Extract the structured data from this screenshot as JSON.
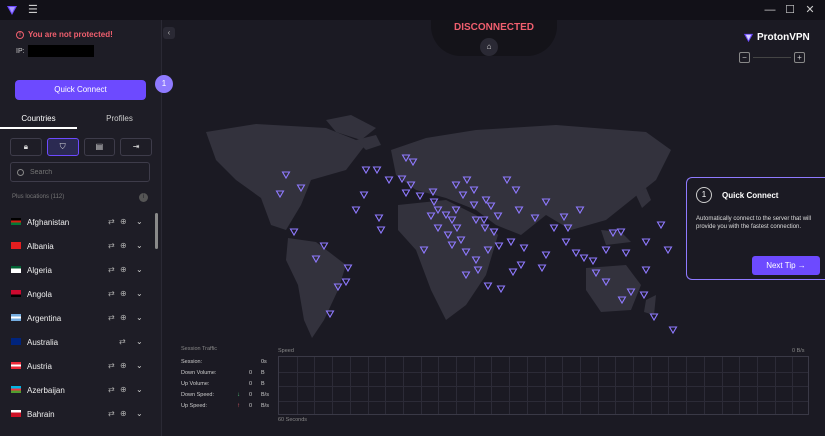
{
  "window": {
    "minimize": "—",
    "maximize": "☐",
    "close": "✕"
  },
  "sidebar": {
    "warning": "You are not protected!",
    "ip_label": "IP:",
    "quick_connect": "Quick Connect",
    "onboarding_step": "1",
    "tabs": [
      "Countries",
      "Profiles"
    ],
    "search_placeholder": "Search",
    "plus_locations": "Plus locations (112)",
    "countries": [
      {
        "name": "Afghanistan",
        "flag": [
          "#000000",
          "#d32011",
          "#007a36"
        ]
      },
      {
        "name": "Albania",
        "flag": [
          "#e41e20",
          "#e41e20",
          "#e41e20"
        ]
      },
      {
        "name": "Algeria",
        "flag": [
          "#006233",
          "#ffffff",
          "#ffffff"
        ]
      },
      {
        "name": "Angola",
        "flag": [
          "#cc092f",
          "#cc092f",
          "#000000"
        ]
      },
      {
        "name": "Argentina",
        "flag": [
          "#74acdf",
          "#ffffff",
          "#74acdf"
        ]
      },
      {
        "name": "Australia",
        "flag": [
          "#00247d",
          "#00247d",
          "#00247d"
        ]
      },
      {
        "name": "Austria",
        "flag": [
          "#ed2939",
          "#ffffff",
          "#ed2939"
        ]
      },
      {
        "name": "Azerbaijan",
        "flag": [
          "#00b5e2",
          "#ef3340",
          "#509e2f"
        ]
      },
      {
        "name": "Bahrain",
        "flag": [
          "#ffffff",
          "#ce1126",
          "#ce1126"
        ]
      }
    ]
  },
  "map": {
    "status": "DISCONNECTED",
    "brand": "ProtonVPN",
    "zoom_out": "−",
    "zoom_in": "+"
  },
  "tip": {
    "number": "1",
    "title": "Quick Connect",
    "body": "Automatically connect to the server that will provide you with the fastest connection.",
    "next": "Next Tip"
  },
  "traffic": {
    "title": "Session Traffic",
    "rows": [
      {
        "label": "Session:",
        "value": "0s",
        "unit": ""
      },
      {
        "label": "Down Volume:",
        "value": "0",
        "unit": "B"
      },
      {
        "label": "Up Volume:",
        "value": "0",
        "unit": "B"
      },
      {
        "label": "Down Speed:",
        "value": "0",
        "unit": "B/s"
      },
      {
        "label": "Up Speed:",
        "value": "0",
        "unit": "B/s"
      }
    ],
    "speed_label": "Speed",
    "speed_max": "0 B/s",
    "time_label": "60 Seconds"
  },
  "colors": {
    "accent": "#6d4aff",
    "danger": "#f05f6e",
    "land": "#33323d",
    "server": "#8f7aff"
  }
}
